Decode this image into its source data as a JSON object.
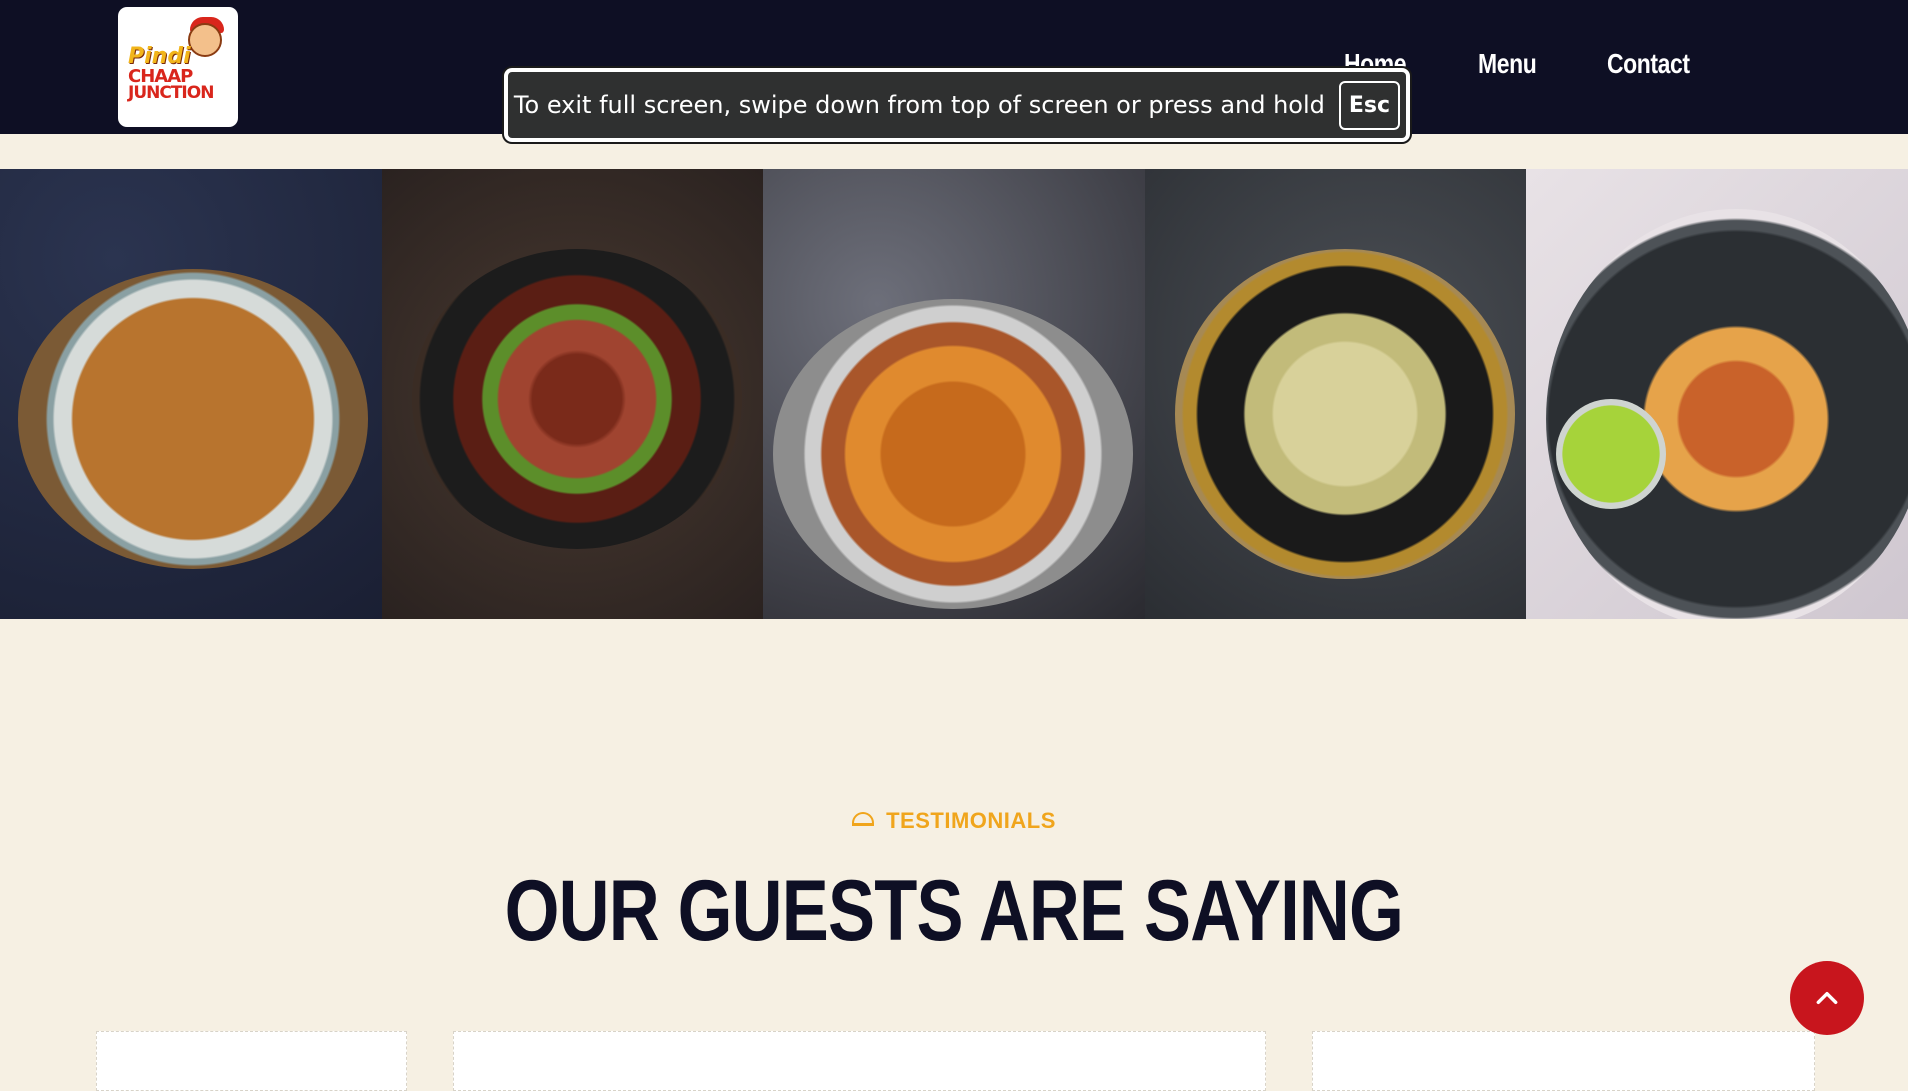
{
  "brand": {
    "logo_line1": "Pindi",
    "logo_line2": "CHAAP",
    "logo_line3": "JUNCTION",
    "colors": {
      "header_bg": "#0e0f24",
      "accent": "#f0a51c",
      "page_bg": "#f6f0e3",
      "button_red": "#c8151d"
    }
  },
  "nav": {
    "items": [
      "Home",
      "Menu",
      "Contact"
    ]
  },
  "fullscreen_toast": {
    "message": "To exit full screen, swipe down from top of screen or press and hold",
    "key": "Esc"
  },
  "gallery": {
    "icons": [
      "noodles-photo",
      "chilli-paneer-photo",
      "mushroom-curry-photo",
      "malai-chaap-photo",
      "paneer-tikka-skewers-photo"
    ]
  },
  "testimonials": {
    "tag_icon": "cloche-icon",
    "tag": "TESTIMONIALS",
    "heading": "OUR GUESTS ARE SAYING"
  },
  "scroll_top": {
    "icon": "chevron-up-icon"
  }
}
